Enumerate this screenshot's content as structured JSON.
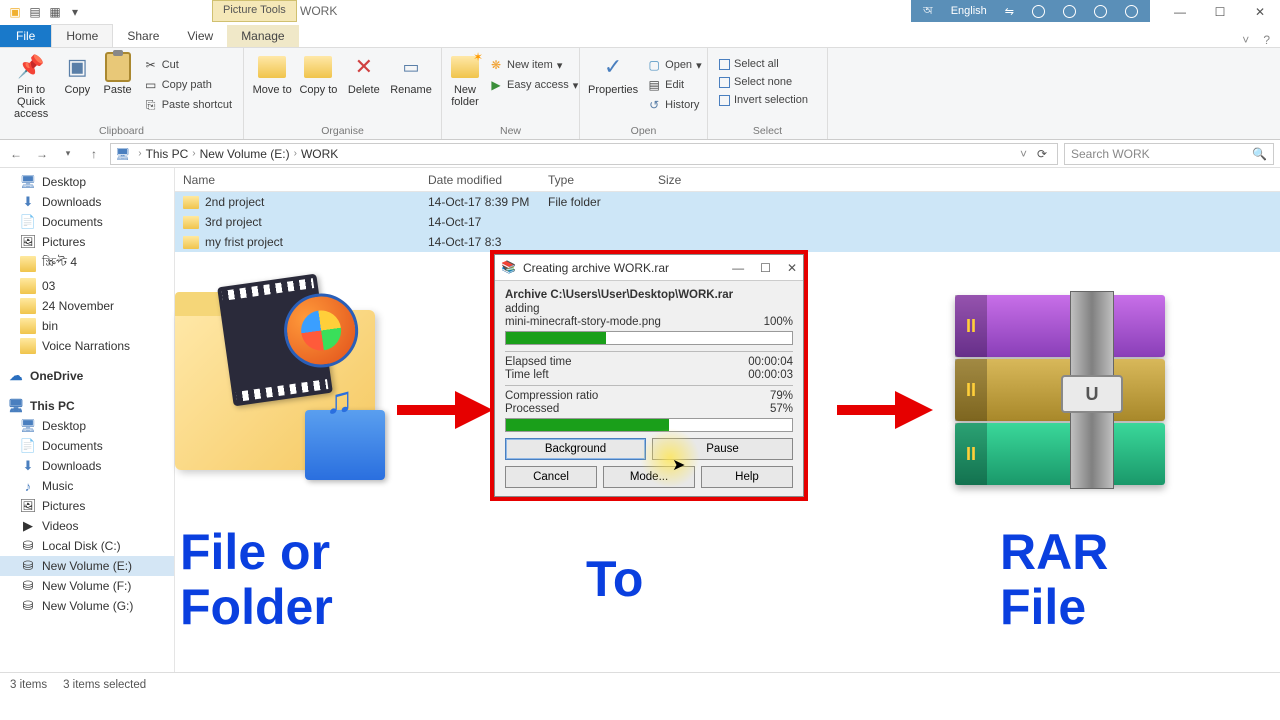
{
  "titlebar": {
    "picture_tools": "Picture Tools",
    "title": "WORK",
    "lang1": "অ",
    "lang2": "English",
    "min": "—",
    "max": "☐",
    "close": "✕"
  },
  "tabs": {
    "file": "File",
    "home": "Home",
    "share": "Share",
    "view": "View",
    "manage": "Manage"
  },
  "ribbon": {
    "clipboard": {
      "label": "Clipboard",
      "pin": "Pin to Quick access",
      "copy": "Copy",
      "paste": "Paste",
      "cut": "Cut",
      "copy_path": "Copy path",
      "paste_shortcut": "Paste shortcut"
    },
    "organise": {
      "label": "Organise",
      "move_to": "Move to",
      "copy_to": "Copy to",
      "delete": "Delete",
      "rename": "Rename"
    },
    "new": {
      "label": "New",
      "new_folder": "New folder",
      "new_item": "New item",
      "easy_access": "Easy access"
    },
    "open": {
      "label": "Open",
      "properties": "Properties",
      "open": "Open",
      "edit": "Edit",
      "history": "History"
    },
    "select": {
      "label": "Select",
      "all": "Select all",
      "none": "Select none",
      "invert": "Invert selection"
    }
  },
  "address": {
    "this_pc": "This PC",
    "vol": "New Volume (E:)",
    "folder": "WORK",
    "search_ph": "Search WORK"
  },
  "tree": {
    "desktop": "Desktop",
    "downloads": "Downloads",
    "documents": "Documents",
    "pictures": "Pictures",
    "bangla": "স্ক্রিপ্ট 4",
    "n03": "03",
    "n24": "24 November",
    "bin": "bin",
    "voice": "Voice Narrations",
    "onedrive": "OneDrive",
    "this_pc": "This PC",
    "desktop2": "Desktop",
    "documents2": "Documents",
    "downloads2": "Downloads",
    "music": "Music",
    "pictures2": "Pictures",
    "videos": "Videos",
    "local_c": "Local Disk (C:)",
    "vol_e": "New Volume (E:)",
    "vol_f": "New Volume (F:)",
    "vol_g": "New Volume (G:)"
  },
  "columns": {
    "name": "Name",
    "date": "Date modified",
    "type": "Type",
    "size": "Size"
  },
  "files": [
    {
      "name": "2nd project",
      "date": "14-Oct-17 8:39 PM",
      "type": "File folder",
      "size": ""
    },
    {
      "name": "3rd project",
      "date": "14-Oct-17",
      "type": "",
      "size": ""
    },
    {
      "name": "my frist project",
      "date": "14-Oct-17 8:3",
      "type": "",
      "size": ""
    }
  ],
  "statusbar": {
    "items": "3 items",
    "selected": "3 items selected"
  },
  "dialog": {
    "title": "Creating archive WORK.rar",
    "path": "Archive C:\\Users\\User\\Desktop\\WORK.rar",
    "adding": "adding",
    "file": "mini-minecraft-story-mode.png",
    "file_pct": "100%",
    "elapsed_l": "Elapsed time",
    "elapsed_v": "00:00:04",
    "left_l": "Time left",
    "left_v": "00:00:03",
    "ratio_l": "Compression ratio",
    "ratio_v": "79%",
    "proc_l": "Processed",
    "proc_v": "57%",
    "background": "Background",
    "pause": "Pause",
    "cancel": "Cancel",
    "mode": "Mode...",
    "help": "Help"
  },
  "captions": {
    "left1": "File or",
    "left2": "Folder",
    "mid": "To",
    "right1": "RAR",
    "right2": "File"
  }
}
